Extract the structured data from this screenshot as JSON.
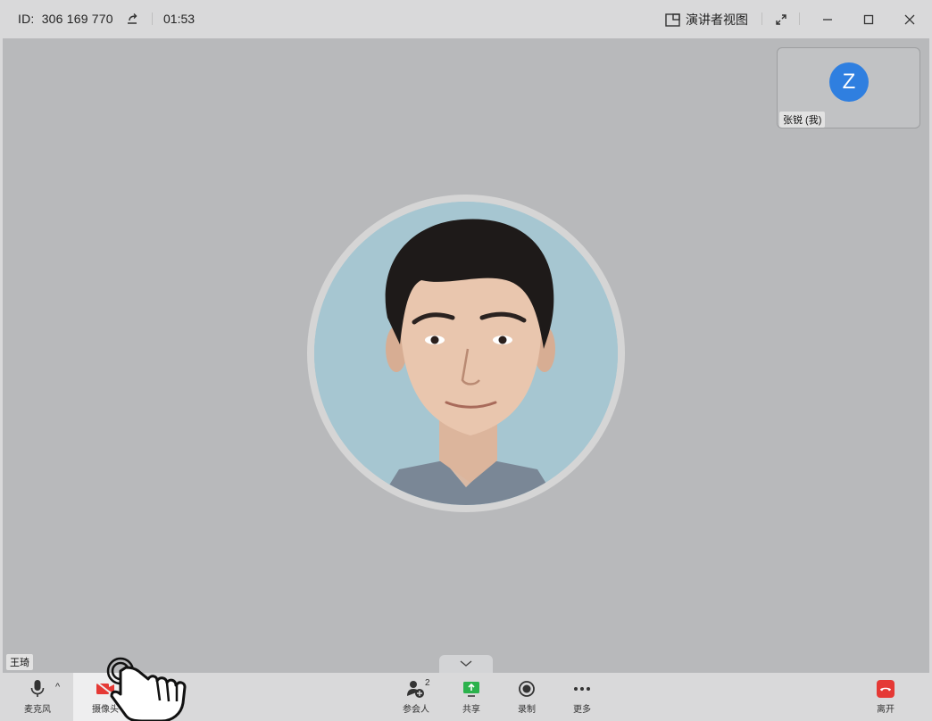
{
  "titlebar": {
    "meeting_id_label": "ID:",
    "meeting_id": "306 169 770",
    "timer": "01:53",
    "speaker_view_label": "演讲者视图"
  },
  "stage": {
    "self_tile": {
      "avatar_letter": "Z",
      "name": "张锐 (我)",
      "avatar_color": "#2f7fe0"
    },
    "remote_name": "王琦"
  },
  "toolbar": {
    "mic_label": "麦克风",
    "camera_label": "摄像头",
    "participants_label": "参会人",
    "participants_count": "2",
    "share_label": "共享",
    "record_label": "录制",
    "more_label": "更多",
    "leave_label": "离开"
  },
  "colors": {
    "camera_off_red": "#e53935",
    "share_green": "#2bb24c",
    "leave_red": "#e53935",
    "stage_bg": "#b8b9bb"
  }
}
